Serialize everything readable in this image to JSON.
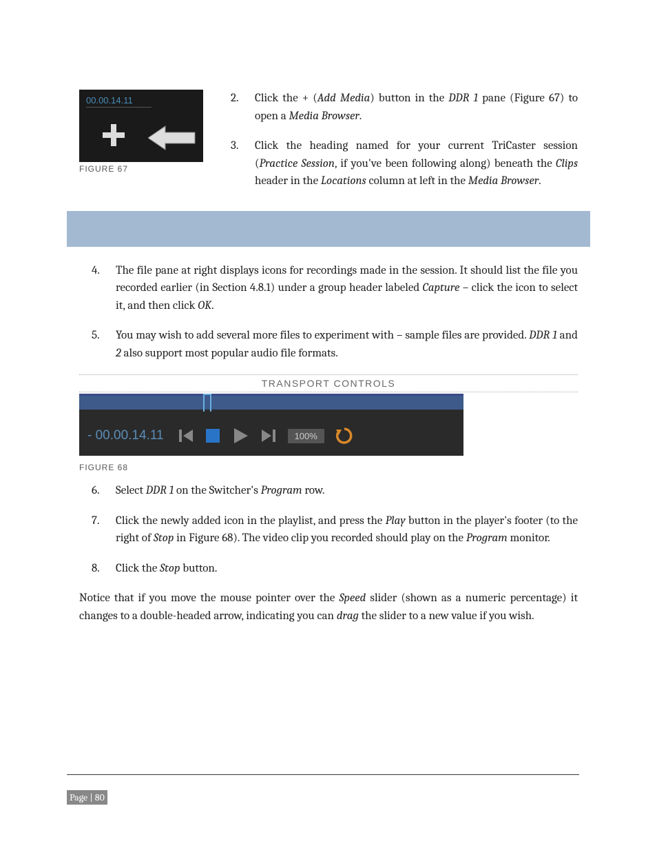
{
  "figure67": {
    "timecode": "00.00.14.11",
    "label": "FIGURE 67"
  },
  "topList": {
    "item2": {
      "num": "2.",
      "text_1": "Click the + (",
      "text_2_italic": "Add Media",
      "text_3": ") button in the ",
      "text_4_italic": "DDR 1",
      "text_5": " pane (Figure 67) to open a ",
      "text_6_italic": "Media Browser",
      "text_7": "."
    },
    "item3": {
      "num": "3.",
      "text_1": "Click the heading named for your current TriCaster session (",
      "text_2_italic": "Practice Session",
      "text_3": ", if you've been following along) beneath the ",
      "text_4_italic": "Clips",
      "text_5": " header in the ",
      "text_6_italic": "Locations",
      "text_7": " column at left in the ",
      "text_8_italic": "Media Browser",
      "text_9": "."
    }
  },
  "bodyList": {
    "item4": {
      "num": "4.",
      "text_1": "The file pane at right displays icons for recordings made in the session.  It should list the file you recorded earlier (in Section 4.8.1) under a group header labeled ",
      "text_2_italic": "Capture",
      "text_3": " – click the icon to select it, and then click ",
      "text_4_italic": "OK",
      "text_5": "."
    },
    "item5": {
      "num": "5.",
      "text_1": "You may wish to add several more files to experiment with – sample files are provided.  ",
      "text_2_italic": "DDR 1",
      "text_3": " and ",
      "text_4_italic": "2",
      "text_5": " also support most popular audio file formats."
    },
    "item6": {
      "num": "6.",
      "text_1": "Select ",
      "text_2_italic": "DDR 1",
      "text_3": " on the Switcher's ",
      "text_4_italic": "Program",
      "text_5": " row."
    },
    "item7": {
      "num": "7.",
      "text_1": "Click the newly added icon in the playlist, and press the ",
      "text_2_italic": "Play",
      "text_3": " button in the player's footer (to the right of ",
      "text_4_italic": "Stop",
      "text_5": " in Figure 68). The video clip you recorded should play on the ",
      "text_6_italic": "Program",
      "text_7": " monitor."
    },
    "item8": {
      "num": "8.",
      "text_1": "Click the ",
      "text_2_italic": "Stop",
      "text_3": " button."
    }
  },
  "sectionHeading": "TRANSPORT CONTROLS",
  "figure68": {
    "timecode": "- 00.00.14.11",
    "speed": "100%",
    "label": "FIGURE 68"
  },
  "finalPara": {
    "text_1": "Notice that if you move the mouse pointer over the ",
    "text_2_italic": "Speed",
    "text_3": " slider (shown as a numeric percentage) it changes to a double-headed arrow, indicating you can ",
    "text_4_italic": "drag",
    "text_5": " the slider to a new value if you wish."
  },
  "pageNumber": "Page | 80"
}
